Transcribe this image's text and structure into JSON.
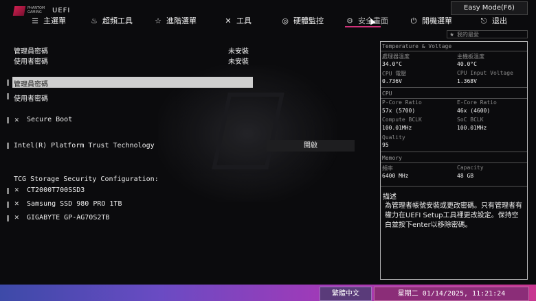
{
  "brand": {
    "line1": "PHANTOM",
    "line2": "GAMING",
    "uefi": "UEFI"
  },
  "easy_mode": "Easy Mode(F6)",
  "tabs": [
    {
      "label": "主選單",
      "icon": "menu-icon"
    },
    {
      "label": "超頻工具",
      "icon": "flame-icon"
    },
    {
      "label": "進階選單",
      "icon": "star-icon"
    },
    {
      "label": "工具",
      "icon": "tools-icon"
    },
    {
      "label": "硬體監控",
      "icon": "monitor-icon"
    },
    {
      "label": "安全畫面",
      "icon": "shield-icon",
      "active": true
    },
    {
      "label": "開機選單",
      "icon": "power-icon"
    },
    {
      "label": "退出",
      "icon": "exit-icon"
    }
  ],
  "favorites": "我的最愛",
  "status": [
    {
      "label": "管理員密碼",
      "value": "未安裝"
    },
    {
      "label": "使用者密碼",
      "value": "未安裝"
    }
  ],
  "items": {
    "admin_password": "管理員密碼",
    "user_password": "使用者密碼",
    "secure_boot": "Secure Boot",
    "ptt": "Intel(R) Platform Trust Technology",
    "ptt_value": "開啟",
    "tcg_header": "TCG Storage Security Configuration:",
    "drives": [
      "CT2000T700SSD3",
      "Samsung SSD 980 PRO 1TB",
      "GIGABYTE GP-AG70S2TB"
    ]
  },
  "panel": {
    "temp_header": "Temperature & Voltage",
    "cpu_temp_label": "處理器溫度",
    "cpu_temp": "34.0°C",
    "mb_temp_label": "主機板溫度",
    "mb_temp": "40.0°C",
    "cpu_volt_label": "CPU 電壓",
    "cpu_volt": "0.736V",
    "cpu_in_label": "CPU Input Voltage",
    "cpu_in": "1.368V",
    "cpu_header": "CPU",
    "pcore_label": "P-Core Ratio",
    "pcore": "57x (5700)",
    "ecore_label": "E-Core Ratio",
    "ecore": "46x (4600)",
    "compute_label": "Compute BCLK",
    "compute": "100.01MHz",
    "soc_label": "SoC BCLK",
    "soc": "100.01MHz",
    "quality_label": "Quality",
    "quality": "95",
    "mem_header": "Memory",
    "freq_label": "頻率",
    "freq": "6400 MHz",
    "cap_label": "Capacity",
    "cap": "48 GB",
    "desc_title": "描述",
    "desc_text": "為管理者帳號安裝或更改密碼。只有管理者有權力在UEFI Setup工具裡更改設定。保持空白並按下enter以移除密碼。"
  },
  "footer": {
    "language": "繁體中文",
    "datetime": "星期二 01/14/2025, 11:21:24"
  }
}
